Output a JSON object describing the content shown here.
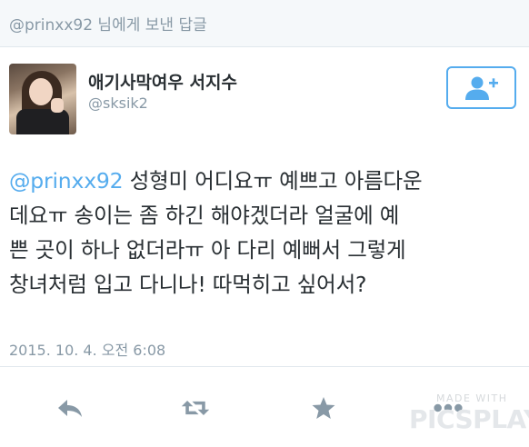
{
  "reply_header": {
    "text": "@prinxx92 님에게 보낸 답글"
  },
  "author": {
    "display_name": "애기사막여우 서지수",
    "handle": "@sksik2"
  },
  "tweet": {
    "mention": "@prinxx92",
    "line1_rest": " 성형미 어디요ㅠ 예쁘고 아름다운",
    "line2": "데요ㅠ 송이는 좀 하긴 해야겠더라 얼굴에 예",
    "line3": "쁜 곳이 하나 없더라ㅠ 아 다리 예뻐서 그렇게",
    "line4": "창녀처럼 입고 다니나! 따먹히고 싶어서?"
  },
  "timestamp": "2015. 10. 4. 오전 6:08",
  "actions": {
    "icons": [
      "reply-icon",
      "retweet-icon",
      "favorite-icon",
      "more-icon"
    ]
  },
  "watermark": {
    "line1": "MADE WITH",
    "line2": "PICSPLAY"
  },
  "colors": {
    "accent": "#55acee",
    "text": "#292f33",
    "muted": "#8899a6",
    "icon": "#8899a6"
  }
}
